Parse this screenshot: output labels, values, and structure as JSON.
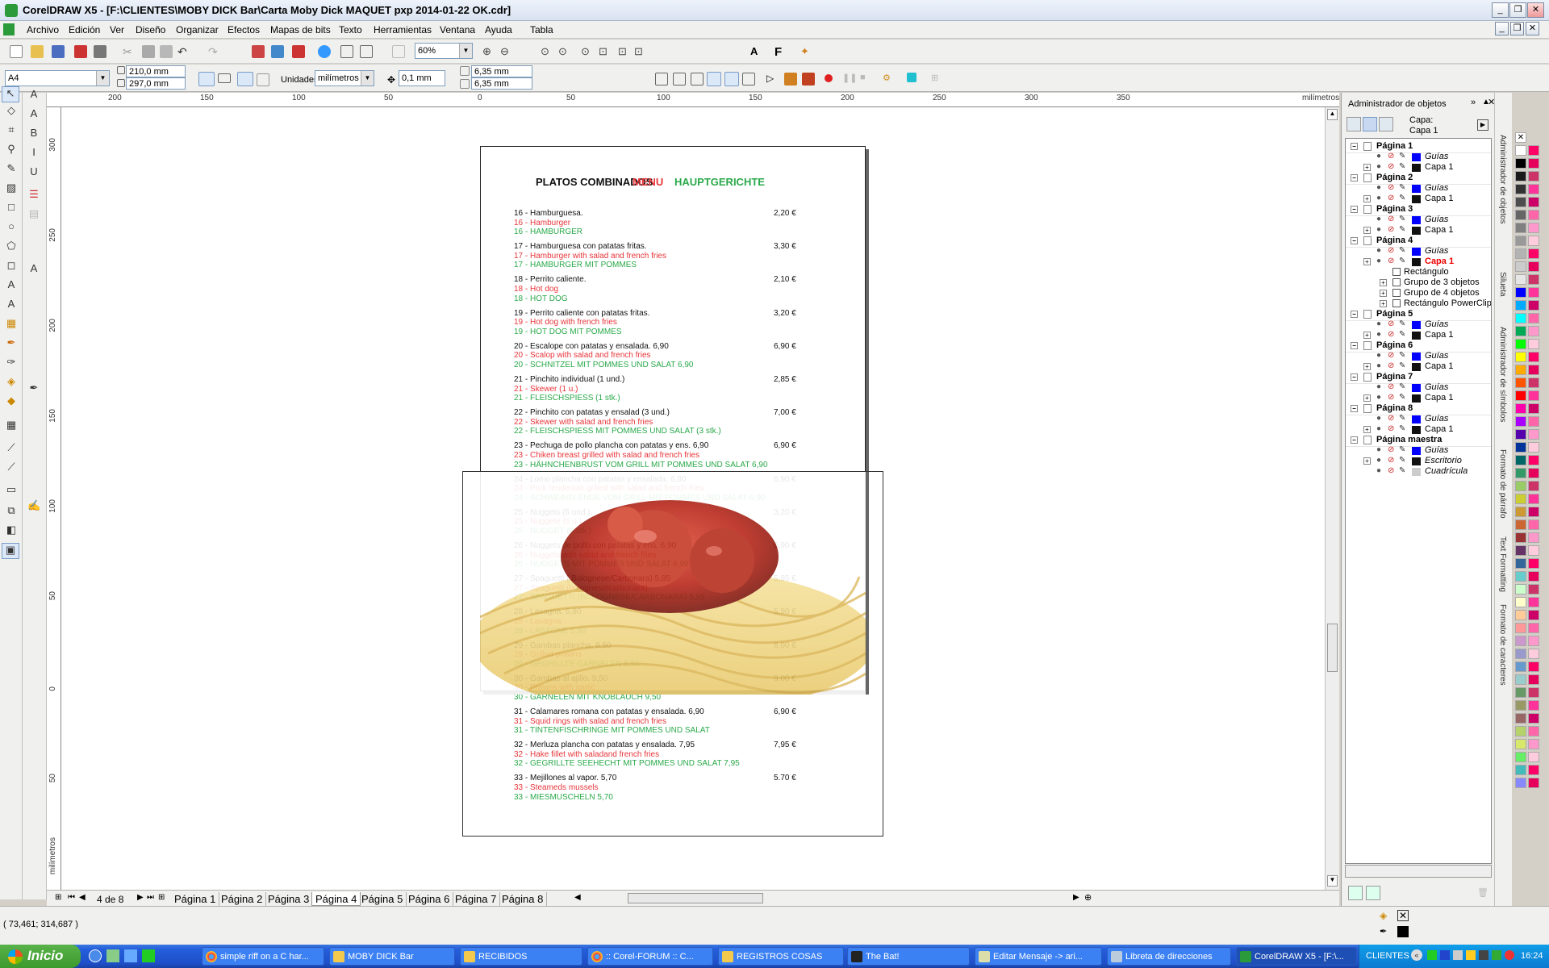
{
  "window": {
    "title": "CorelDRAW X5 - [F:\\CLIENTES\\MOBY DICK Bar\\Carta Moby Dick MAQUET pxp 2014-01-22 OK.cdr]"
  },
  "menu": [
    "Archivo",
    "Edición",
    "Ver",
    "Diseño",
    "Organizar",
    "Efectos",
    "Mapas de bits",
    "Texto",
    "Herramientas",
    "Ventana",
    "Ayuda",
    "Tabla"
  ],
  "toolbar": {
    "zoom": "60%",
    "page_size": "A4",
    "width": "210,0 mm",
    "height": "297,0 mm",
    "units_label": "Unidades:",
    "units": "milímetros",
    "nudge": "0,1 mm",
    "dup_x": "6,35 mm",
    "dup_y": "6,35 mm"
  },
  "ruler": {
    "h_ticks": [
      "200",
      "150",
      "100",
      "50",
      "0",
      "50",
      "100",
      "150",
      "200",
      "250",
      "300",
      "350"
    ],
    "h_unit": "milímetros",
    "v_ticks": [
      "300",
      "250",
      "200",
      "150",
      "100",
      "50",
      "0",
      "50"
    ],
    "v_unit": "milímetros"
  },
  "document": {
    "heading_es": "PLATOS COMBINADOS",
    "heading_en": "MENU",
    "heading_de": "HAUPTGERICHTE",
    "items": [
      {
        "es": "16 - Hamburguesa.",
        "en": "16 - Hamburger",
        "de": "16 - HAMBURGER",
        "price": "2,20 €"
      },
      {
        "es": "17 - Hamburguesa con patatas fritas.",
        "en": "17 - Hamburger with salad and french fries",
        "de": "17 - HAMBURGER MIT POMMES",
        "price": "3,30 €"
      },
      {
        "es": "18 - Perrito caliente.",
        "en": "18 - Hot dog",
        "de": "18 - HOT DOG",
        "price": "2,10 €"
      },
      {
        "es": "19 - Perrito caliente con patatas fritas.",
        "en": "19 - Hot dog with french fries",
        "de": "19 - HOT DOG MIT POMMES",
        "price": "3,20 €"
      },
      {
        "es": "20 - Escalope con patatas y ensalada.    6,90",
        "en": "20 - Scalop with salad and french fries",
        "de": "20 - SCHNITZEL MIT POMMES UND SALAT   6,90",
        "price": "6,90 €"
      },
      {
        "es": "21 - Pinchito individual (1 und.)",
        "en": "21 - Skewer (1 u.)",
        "de": "21 - FLEISCHSPIESS (1 stk.)",
        "price": "2,85 €"
      },
      {
        "es": "22 - Pinchito con patatas y ensalad (3 und.)",
        "en": "22 - Skewer with salad and french fries",
        "de": "22 - FLEISCHSPIESS MIT POMMES UND SALAT (3 stk.)",
        "price": "7,00 €"
      },
      {
        "es": "23 - Pechuga de pollo plancha con patatas y ens.  6,90",
        "en": "23 - Chiken breast grilled with salad and french fries",
        "de": "23 - HÄHNCHENBRUST VOM GRILL MIT POMMES UND SALAT 6,90",
        "price": "6,90 €"
      },
      {
        "es": "24 - Lomo plancha con patatas y ensalada.    6,90",
        "en": "24 - Pork tenderloin grilled with salad and french fries",
        "de": "24 - SCHWEINELENDE VOM GRILL MIT POMMES UND SALAT 6,90",
        "price": "6,90 €"
      },
      {
        "es": "25 - Nuggets (6 und.)",
        "en": "25 - Nuggete (6 u.)",
        "de": "25 - NUGGET (6 stk.)",
        "price": "3,20 €"
      },
      {
        "es": "26 - Nuggets de pollo con patatas y ens.   6,90",
        "en": "26 - Nuggets with salad and french fries",
        "de": "26 - NUGGETS MIT POMMES UND SALAT 6,90",
        "price": "6,90 €"
      },
      {
        "es": "27 - Spaguetti ( Bolognese/Carbonara)  5,95",
        "en": "27 - Spaguetti (bolognese/carbonara)",
        "de": "27 - SPAGUETTI (BOLOGNESE/CARBONARA)  5,95",
        "price": "5,95 €"
      },
      {
        "es": "28 - Lasagna.   5,90",
        "en": "28 - Lasagna",
        "de": "28 - LASAGNE   5,90",
        "price": "5,90 €"
      },
      {
        "es": "29 - Gambas plancha.  8,50",
        "en": "29 - Grilled prawns",
        "de": "29 - GEGRILLTE GARNELEN    8,50",
        "price": "8,00 €"
      },
      {
        "es": "30 - Gambas al ajillo.    9,50",
        "en": "30 - Prawns with garlic",
        "de": "30 - GARNELEN MIT KNOBLAUCH    9,50",
        "price": "9,00 €"
      },
      {
        "es": "31 - Calamares romana con patatas y ensalada. 6,90",
        "en": "31 - Squid rings with salad and french fries",
        "de": "31 - TINTENFISCHRINGE MIT POMMES UND SALAT",
        "price": "6,90 €"
      },
      {
        "es": "32 - Merluza plancha con patatas y ensalada. 7,95",
        "en": "32 - Hake fillet with saladand french fries",
        "de": "32 - GEGRILLTE SEEHECHT MIT POMMES UND SALAT 7,95",
        "price": "7,95 €"
      },
      {
        "es": "33 - Mejillones al vapor. 5,70",
        "en": "33 - Steameds mussels",
        "de": "33 - MIESMUSCHELN 5,70",
        "price": "5.70 €"
      }
    ]
  },
  "page_nav": {
    "counter": "4 de 8",
    "tabs": [
      "Página 1",
      "Página 2",
      "Página 3",
      "Página 4",
      "Página 5",
      "Página 6",
      "Página 7",
      "Página 8"
    ],
    "active": "Página 4"
  },
  "status": {
    "coords": "( 73,461; 314,687 )"
  },
  "docker": {
    "title": "Administrador de objetos",
    "layer_label": "Capa:",
    "layer_value": "Capa 1",
    "tree": [
      {
        "kind": "page",
        "label": "Página 1"
      },
      {
        "kind": "guides",
        "label": "Guías"
      },
      {
        "kind": "layer",
        "label": "Capa 1"
      },
      {
        "kind": "page",
        "label": "Página 2"
      },
      {
        "kind": "guides",
        "label": "Guías"
      },
      {
        "kind": "layer",
        "label": "Capa 1"
      },
      {
        "kind": "page",
        "label": "Página 3"
      },
      {
        "kind": "guides",
        "label": "Guías"
      },
      {
        "kind": "layer",
        "label": "Capa 1"
      },
      {
        "kind": "page",
        "label": "Página 4"
      },
      {
        "kind": "guides",
        "label": "Guías"
      },
      {
        "kind": "layer-active",
        "label": "Capa 1"
      },
      {
        "kind": "object",
        "label": "Rectángulo"
      },
      {
        "kind": "object",
        "label": "Grupo de 3 objetos"
      },
      {
        "kind": "object",
        "label": "Grupo de 4 objetos"
      },
      {
        "kind": "object",
        "label": "Rectángulo PowerClip"
      },
      {
        "kind": "page",
        "label": "Página 5"
      },
      {
        "kind": "guides",
        "label": "Guías"
      },
      {
        "kind": "layer",
        "label": "Capa 1"
      },
      {
        "kind": "page",
        "label": "Página 6"
      },
      {
        "kind": "guides",
        "label": "Guías"
      },
      {
        "kind": "layer",
        "label": "Capa 1"
      },
      {
        "kind": "page",
        "label": "Página 7"
      },
      {
        "kind": "guides",
        "label": "Guías"
      },
      {
        "kind": "layer",
        "label": "Capa 1"
      },
      {
        "kind": "page",
        "label": "Página 8"
      },
      {
        "kind": "guides",
        "label": "Guías"
      },
      {
        "kind": "layer",
        "label": "Capa 1"
      },
      {
        "kind": "page",
        "label": "Página maestra"
      },
      {
        "kind": "guides",
        "label": "Guías"
      },
      {
        "kind": "layer",
        "label": "Escritorio"
      },
      {
        "kind": "grid",
        "label": "Cuadrícula"
      }
    ],
    "side_tabs": [
      "Administrador de objetos",
      "Silueta",
      "Administrador de símbolos",
      "Formato de párrafo",
      "Text Formatting",
      "Formato de caracteres"
    ]
  },
  "palette_colors": [
    "#ffffff",
    "#000000",
    "#1a1a1a",
    "#333333",
    "#4d4d4d",
    "#666666",
    "#808080",
    "#999999",
    "#b3b3b3",
    "#cccccc",
    "#e6e6e6",
    "#0000ff",
    "#00aaff",
    "#00ffff",
    "#00aa55",
    "#00ff00",
    "#ffff00",
    "#ffaa00",
    "#ff5500",
    "#ff0000",
    "#ff00aa",
    "#aa00ff",
    "#5500aa",
    "#003399",
    "#006666",
    "#339966",
    "#99cc66",
    "#cccc33",
    "#cc9933",
    "#cc6633",
    "#993333",
    "#663366",
    "#336699",
    "#66cccc",
    "#ccffcc",
    "#ffffcc",
    "#ffcc99",
    "#ff9999",
    "#cc99cc",
    "#9999cc",
    "#6699cc",
    "#99cccc",
    "#669966",
    "#999966",
    "#996666",
    "#b5d36a",
    "#d7e86a",
    "#66ee66",
    "#44bbbb",
    "#8888ff"
  ],
  "palette_pink": [
    "#ff0066",
    "#e6005c",
    "#cc3366",
    "#ff3399",
    "#cc0066",
    "#ff66aa",
    "#ff99cc",
    "#ffccdd"
  ],
  "taskbar": {
    "start": "Inicio",
    "tasks": [
      "simple riff on a C har...",
      "MOBY DICK Bar",
      "RECIBIDOS",
      ":: Corel-FORUM :: C...",
      "REGISTROS COSAS",
      "The Bat!",
      "Editar Mensaje -> ari...",
      "Libreta de direcciones",
      "CorelDRAW X5 - [F:\\..."
    ],
    "tray_label": "CLIENTES",
    "clock": "16:24"
  }
}
